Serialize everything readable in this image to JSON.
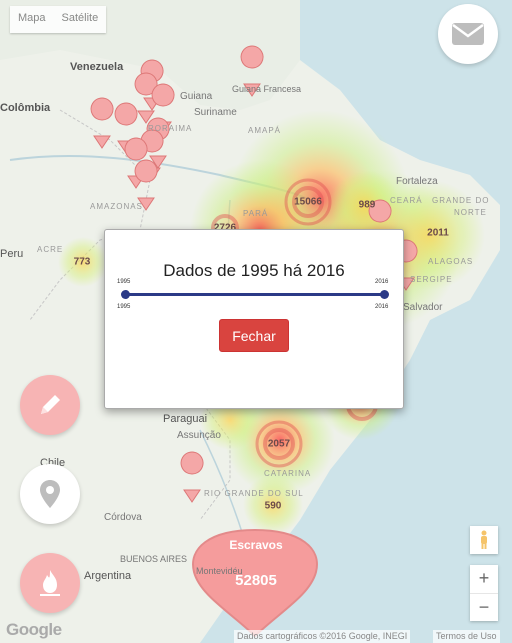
{
  "map": {
    "type_controls": {
      "map": "Mapa",
      "satellite": "Satélite"
    },
    "labels": {
      "venezuela": "Venezuela",
      "colombia": "Colômbia",
      "guiana": "Guiana",
      "suriname": "Suriname",
      "guiana_francesa": "Guiana Francesa",
      "amapa": "AMAPÁ",
      "amazonas": "AMAZONAS",
      "roraima": "RORAIMA",
      "para": "PARÁ",
      "acre": "ACRE",
      "peru": "Peru",
      "fortaleza": "Fortaleza",
      "ceara": "CEARÁ",
      "rio_grande_do_norte_1": "GRANDE DO",
      "rio_grande_do_norte_2": "NORTE",
      "alagoas": "ALAGOAS",
      "sergipe": "SERGIPE",
      "salvador": "Salvador",
      "paraguai": "Paraguai",
      "assuncao": "Assunção",
      "chile": "Chile",
      "santa_catarina": "CATARINA",
      "rio_grande_do_sul": "RIO GRANDE DO SUL",
      "cordova": "Córdova",
      "argentina": "Argentina",
      "buenos_aires": "BUENOS AIRES",
      "montevideu": "Montevidéu"
    },
    "clusters": [
      "15066",
      "989",
      "2011",
      "773",
      "2057",
      "590",
      "2726"
    ],
    "badge": {
      "label": "Escravos",
      "value": "52805"
    },
    "attribution": "Dados cartográficos ©2016 Google, INEGI",
    "terms": "Termos de Uso",
    "google_logo": "Google"
  },
  "modal": {
    "title": "Dados de 1995 há 2016",
    "slider": {
      "min": 1995,
      "max": 2016,
      "low": 1995,
      "high": 2016,
      "min_label": "1995",
      "max_label": "2016",
      "low_label": "1995",
      "high_label": "2016"
    },
    "close_label": "Fechar"
  },
  "controls": {
    "zoom_in": "+",
    "zoom_out": "−"
  },
  "icons": {
    "mail": "envelope-icon",
    "edit": "pencil-icon",
    "location": "map-marker-icon",
    "fire": "fire-icon"
  }
}
